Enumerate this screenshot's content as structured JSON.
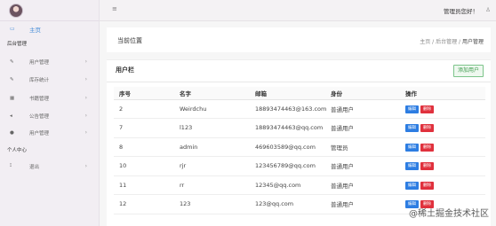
{
  "sidebar": {
    "home_label": "主页",
    "section_admin": "后台管理",
    "items": [
      {
        "label": "用户管理",
        "icon": "edit-icon"
      },
      {
        "label": "库存统计",
        "icon": "edit-icon"
      },
      {
        "label": "书籍管理",
        "icon": "book-icon"
      },
      {
        "label": "公告管理",
        "icon": "megaphone-icon"
      },
      {
        "label": "用户管理",
        "icon": "user-icon"
      }
    ],
    "section_personal": "个人中心",
    "logout_label": "退出"
  },
  "topbar": {
    "greeting": "管理员您好！"
  },
  "page": {
    "crumb_title": "当前位置",
    "breadcrumb": [
      "主页",
      "后台管理",
      "用户管理"
    ],
    "panel_title": "用户栏",
    "add_button": "添加用户"
  },
  "table": {
    "headers": [
      "序号",
      "名字",
      "邮箱",
      "身份",
      "操作"
    ],
    "edit_label": "编辑",
    "delete_label": "删除",
    "rows": [
      {
        "id": "2",
        "name": "Weirdchu",
        "email": "18893474463@163.com",
        "role": "普通用户"
      },
      {
        "id": "7",
        "name": "l123",
        "email": "18893474463@qq.com",
        "role": "普通用户"
      },
      {
        "id": "8",
        "name": "admin",
        "email": "469603589@qq.com",
        "role": "管理员"
      },
      {
        "id": "10",
        "name": "rjr",
        "email": "123456789@qq.com",
        "role": "普通用户"
      },
      {
        "id": "11",
        "name": "rr",
        "email": "12345@qq.com",
        "role": "普通用户"
      },
      {
        "id": "12",
        "name": "123",
        "email": "123@qq.com",
        "role": "普通用户"
      }
    ]
  },
  "watermark": "@稀土掘金技术社区",
  "colors": {
    "accent": "#4a8fd8",
    "edit": "#2d7de2",
    "delete": "#e0313d",
    "add": "#3c9a4c"
  }
}
